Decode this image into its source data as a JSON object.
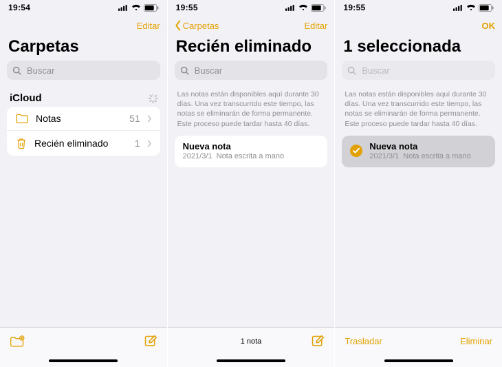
{
  "screens": [
    {
      "status_time": "19:54",
      "nav_right": "Editar",
      "title": "Carpetas",
      "search_placeholder": "Buscar",
      "section": "iCloud",
      "folders": [
        {
          "icon": "folder",
          "label": "Notas",
          "count": "51"
        },
        {
          "icon": "trash",
          "label": "Recién eliminado",
          "count": "1"
        }
      ],
      "toolbar_center": ""
    },
    {
      "status_time": "19:55",
      "nav_back": "Carpetas",
      "nav_right": "Editar",
      "title": "Recién eliminado",
      "search_placeholder": "Buscar",
      "info": "Las notas están disponibles aquí durante 30 días. Una vez transcurrido este tiempo, las notas se eliminarán de forma permanente. Este proceso puede tardar hasta 40 días.",
      "note": {
        "title": "Nueva nota",
        "date": "2021/3/1",
        "meta": "Nota escrita a mano"
      },
      "toolbar_center": "1 nota"
    },
    {
      "status_time": "19:55",
      "nav_right": "OK",
      "title": "1 seleccionada",
      "search_placeholder": "Buscar",
      "info": "Las notas están disponibles aquí durante 30 días. Una vez transcurrido este tiempo, las notas se eliminarán de forma permanente. Este proceso puede tardar hasta 40 días.",
      "note": {
        "title": "Nueva nota",
        "date": "2021/3/1",
        "meta": "Nota escrita a mano"
      },
      "toolbar_left": "Trasladar",
      "toolbar_right": "Eliminar"
    }
  ]
}
